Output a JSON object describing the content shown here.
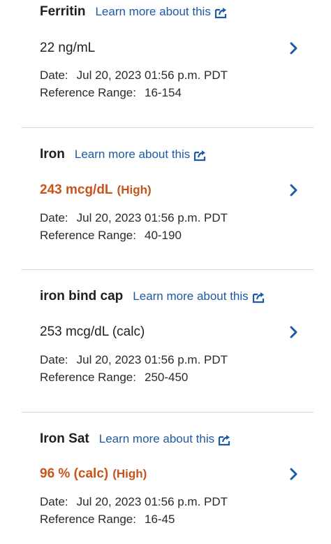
{
  "results": [
    {
      "name": "Ferritin",
      "link_text": "Learn more about this",
      "value": "22 ng/mL",
      "flag": "",
      "date_label": "Date:",
      "date": "Jul 20, 2023 01:56 p.m. PDT",
      "range_label": "Reference Range:",
      "range": "16-154"
    },
    {
      "name": "Iron",
      "link_text": "Learn more about this",
      "value": "243 mcg/dL",
      "flag": "(High)",
      "date_label": "Date:",
      "date": "Jul 20, 2023 01:56 p.m. PDT",
      "range_label": "Reference Range:",
      "range": "40-190"
    },
    {
      "name": "iron bind cap",
      "link_text": "Learn more about this",
      "value": "253 mcg/dL (calc)",
      "flag": "",
      "date_label": "Date:",
      "date": "Jul 20, 2023 01:56 p.m. PDT",
      "range_label": "Reference Range:",
      "range": "250-450"
    },
    {
      "name": "Iron Sat",
      "link_text": "Learn more about this",
      "value": "96 % (calc)",
      "flag": "(High)",
      "date_label": "Date:",
      "date": "Jul 20, 2023 01:56 p.m. PDT",
      "range_label": "Reference Range:",
      "range": "16-45"
    }
  ],
  "colors": {
    "link": "#1d5aa3",
    "high_value": "#c8541a",
    "divider": "#d6d6d6"
  },
  "icons": {
    "link_icon": "external-link-icon",
    "row_icon": "chevron-right-icon"
  }
}
